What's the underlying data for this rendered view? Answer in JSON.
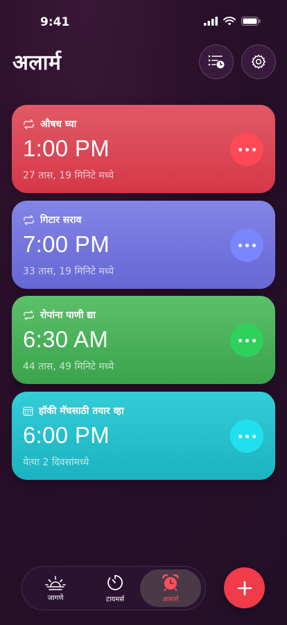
{
  "status_bar": {
    "time": "9:41"
  },
  "header": {
    "title": "अलार्म"
  },
  "alarms": [
    {
      "label": "औषध घ्या",
      "time": "1:00 PM",
      "remaining": "27 तास, 19 मिनिटे मध्ये",
      "repeat": "repeat-icon",
      "color": "#d63748"
    },
    {
      "label": "गिटार सराव",
      "time": "7:00 PM",
      "remaining": "33 तास, 19 मिनिटे मध्ये",
      "repeat": "repeat-icon",
      "color": "#6567d4"
    },
    {
      "label": "रोपांना पाणी द्या",
      "time": "6:30 AM",
      "remaining": "44 तास, 49 मिनिटे मध्ये",
      "repeat": "repeat-icon",
      "color": "#3aa34b"
    },
    {
      "label": "हॉकी मॅचसाठी तयार व्हा",
      "time": "6:00 PM",
      "remaining": "येत्या 2 दिवसांमध्ये",
      "repeat": "calendar-icon",
      "color": "#1bb3c1"
    }
  ],
  "tabs": [
    {
      "label": "जागणे",
      "icon": "sunrise-icon"
    },
    {
      "label": "टायमर्स",
      "icon": "timer-icon"
    },
    {
      "label": "अलार्म",
      "icon": "alarm-clock-icon",
      "active": true
    }
  ],
  "accent_color": "#ef3b4a"
}
